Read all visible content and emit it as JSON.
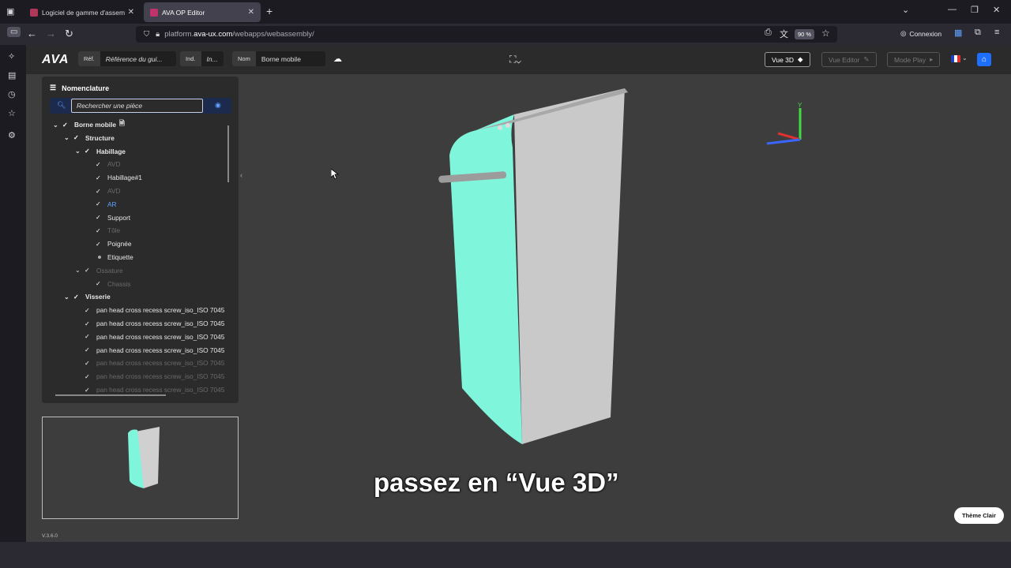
{
  "browser": {
    "tabs": [
      {
        "title": "Logiciel de gamme d'assemblage",
        "active": false,
        "favicon_color": "#b0365a"
      },
      {
        "title": "AVA OP Editor",
        "active": true,
        "favicon_color": "#c0326a"
      }
    ],
    "url_domain": "platform.ava-ux.com",
    "url_path": "/webapps/webassembly/",
    "url_prefix": "platform.",
    "url_domain_main": "ava-ux.com",
    "zoom": "90 %",
    "connexion": "Connexion"
  },
  "header": {
    "logo": "AVA",
    "ref_label": "Réf.",
    "ref_value": "Référence du gui...",
    "ind_label": "Ind.",
    "ind_value": "In...",
    "nom_label": "Nom",
    "nom_value": "Borne mobile",
    "vue3d": "Vue 3D",
    "vue_editor": "Vue Editor",
    "mode_play": "Mode Play"
  },
  "panel": {
    "title": "Nomenclature",
    "search_placeholder": "Rechercher une pièce",
    "tree": [
      {
        "label": "Borne mobile",
        "level": 0,
        "bold": true,
        "chev": true,
        "check": true,
        "doc": true
      },
      {
        "label": "Structure",
        "level": 1,
        "bold": true,
        "chev": true,
        "check": true
      },
      {
        "label": "Habillage",
        "level": 2,
        "bold": true,
        "chev": true,
        "check": true
      },
      {
        "label": "AVD",
        "level": 3,
        "dim": true,
        "check": true
      },
      {
        "label": "Habillage#1",
        "level": 3,
        "check": true
      },
      {
        "label": "AVD",
        "level": 3,
        "dim": true,
        "check": true
      },
      {
        "label": "AR",
        "level": 3,
        "blue": true,
        "check": true
      },
      {
        "label": "Support",
        "level": 3,
        "check": true
      },
      {
        "label": "Tôle",
        "level": 3,
        "dim": true,
        "check": true
      },
      {
        "label": "Poignée",
        "level": 3,
        "check": true
      },
      {
        "label": "Etiquette",
        "level": 3,
        "dot": true
      },
      {
        "label": "Ossature",
        "level": 2,
        "dim": true,
        "chev": true,
        "check": true
      },
      {
        "label": "Chassis",
        "level": 3,
        "dim": true,
        "check": true
      },
      {
        "label": "Visserie",
        "level": 1,
        "bold": true,
        "chev": true,
        "check": true
      },
      {
        "label": "pan head cross recess screw_iso_ISO 7045",
        "level": 2,
        "check": true
      },
      {
        "label": "pan head cross recess screw_iso_ISO 7045",
        "level": 2,
        "check": true
      },
      {
        "label": "pan head cross recess screw_iso_ISO 7045",
        "level": 2,
        "check": true
      },
      {
        "label": "pan head cross recess screw_iso_ISO 7045",
        "level": 2,
        "check": true
      },
      {
        "label": "pan head cross recess screw_iso_ISO 7045",
        "level": 2,
        "dim": true,
        "check": true
      },
      {
        "label": "pan head cross recess screw_iso_ISO 7045",
        "level": 2,
        "dim": true,
        "check": true
      },
      {
        "label": "pan head cross recess screw_iso_ISO 7045",
        "level": 2,
        "dim": true,
        "check": true
      }
    ]
  },
  "viewport": {
    "model_color_front": "#7ff5dc",
    "model_color_side": "#c8c8c8",
    "axis_label": "Y"
  },
  "subtitle": "passez en “Vue 3D”",
  "theme_button": "Thème Clair",
  "version": "V.3.6.0"
}
